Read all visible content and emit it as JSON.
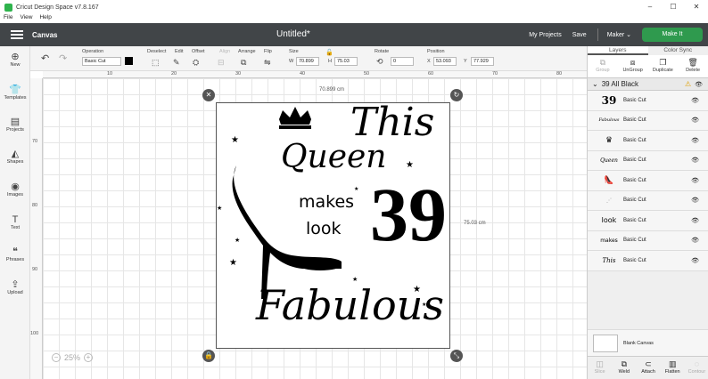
{
  "window": {
    "title": "Cricut Design Space  v7.8.167",
    "min": "–",
    "max": "☐",
    "close": "✕"
  },
  "menu": [
    "File",
    "View",
    "Help"
  ],
  "header": {
    "section": "Canvas",
    "doc_title": "Untitled*",
    "my_projects": "My Projects",
    "save": "Save",
    "machine": "Maker",
    "make_it": "Make It"
  },
  "toolbar": {
    "undo": "↶",
    "redo": "↷",
    "operation_label": "Operation",
    "operation_value": "Basic Cut",
    "deselect": "Deselect",
    "edit": "Edit",
    "offset": "Offset",
    "align": "Align",
    "arrange": "Arrange",
    "flip": "Flip",
    "size_label": "Size",
    "w_label": "W",
    "w_value": "70.899",
    "h_label": "H",
    "h_value": "75.03",
    "rotate_label": "Rotate",
    "rotate_value": "0",
    "position_label": "Position",
    "x_label": "X",
    "x_value": "53.093",
    "y_label": "Y",
    "y_value": "77.929"
  },
  "leftbar": [
    {
      "label": "New",
      "icon": "⊕"
    },
    {
      "label": "Templates",
      "icon": "👕"
    },
    {
      "label": "Projects",
      "icon": "▤"
    },
    {
      "label": "Shapes",
      "icon": "◭"
    },
    {
      "label": "Images",
      "icon": "◉"
    },
    {
      "label": "Text",
      "icon": "T"
    },
    {
      "label": "Phrases",
      "icon": "❝"
    },
    {
      "label": "Upload",
      "icon": "⇪"
    }
  ],
  "rulers": {
    "top": [
      "10",
      "20",
      "30",
      "40",
      "50",
      "60",
      "70",
      "80",
      "90"
    ],
    "left": [
      "70",
      "80",
      "90",
      "100",
      "110"
    ]
  },
  "canvas": {
    "width_label": "70.899 cm",
    "height_label": "75.03 cm",
    "zoom": "25%",
    "design": {
      "line1": "This",
      "line2": "Queen",
      "line3": "makes",
      "line4": "look",
      "number": "39",
      "line5": "Fabulous"
    }
  },
  "panel": {
    "tabs": [
      "Layers",
      "Color Sync"
    ],
    "actions": [
      {
        "label": "Group",
        "icon": "⧉",
        "enabled": false
      },
      {
        "label": "UnGroup",
        "icon": "⧈",
        "enabled": true
      },
      {
        "label": "Duplicate",
        "icon": "❐",
        "enabled": true
      },
      {
        "label": "Delete",
        "icon": "🗑",
        "enabled": true
      }
    ],
    "group_name": "39 All Black",
    "layers": [
      {
        "thumb": "39",
        "name": "Basic Cut"
      },
      {
        "thumb": "Fabulous",
        "name": "Basic Cut"
      },
      {
        "thumb": "♛",
        "name": "Basic Cut"
      },
      {
        "thumb": "Queen",
        "name": "Basic Cut"
      },
      {
        "thumb": "👠",
        "name": "Basic Cut"
      },
      {
        "thumb": "⋰",
        "name": "Basic Cut"
      },
      {
        "thumb": "look",
        "name": "Basic Cut"
      },
      {
        "thumb": "makes",
        "name": "Basic Cut"
      },
      {
        "thumb": "This",
        "name": "Basic Cut"
      }
    ],
    "blank_canvas": "Blank Canvas",
    "bottom_actions": [
      {
        "label": "Slice",
        "icon": "◫",
        "enabled": false
      },
      {
        "label": "Weld",
        "icon": "⧉",
        "enabled": true
      },
      {
        "label": "Attach",
        "icon": "⊂",
        "enabled": true
      },
      {
        "label": "Flatten",
        "icon": "▥",
        "enabled": true
      },
      {
        "label": "Contour",
        "icon": "◌",
        "enabled": false
      }
    ]
  }
}
